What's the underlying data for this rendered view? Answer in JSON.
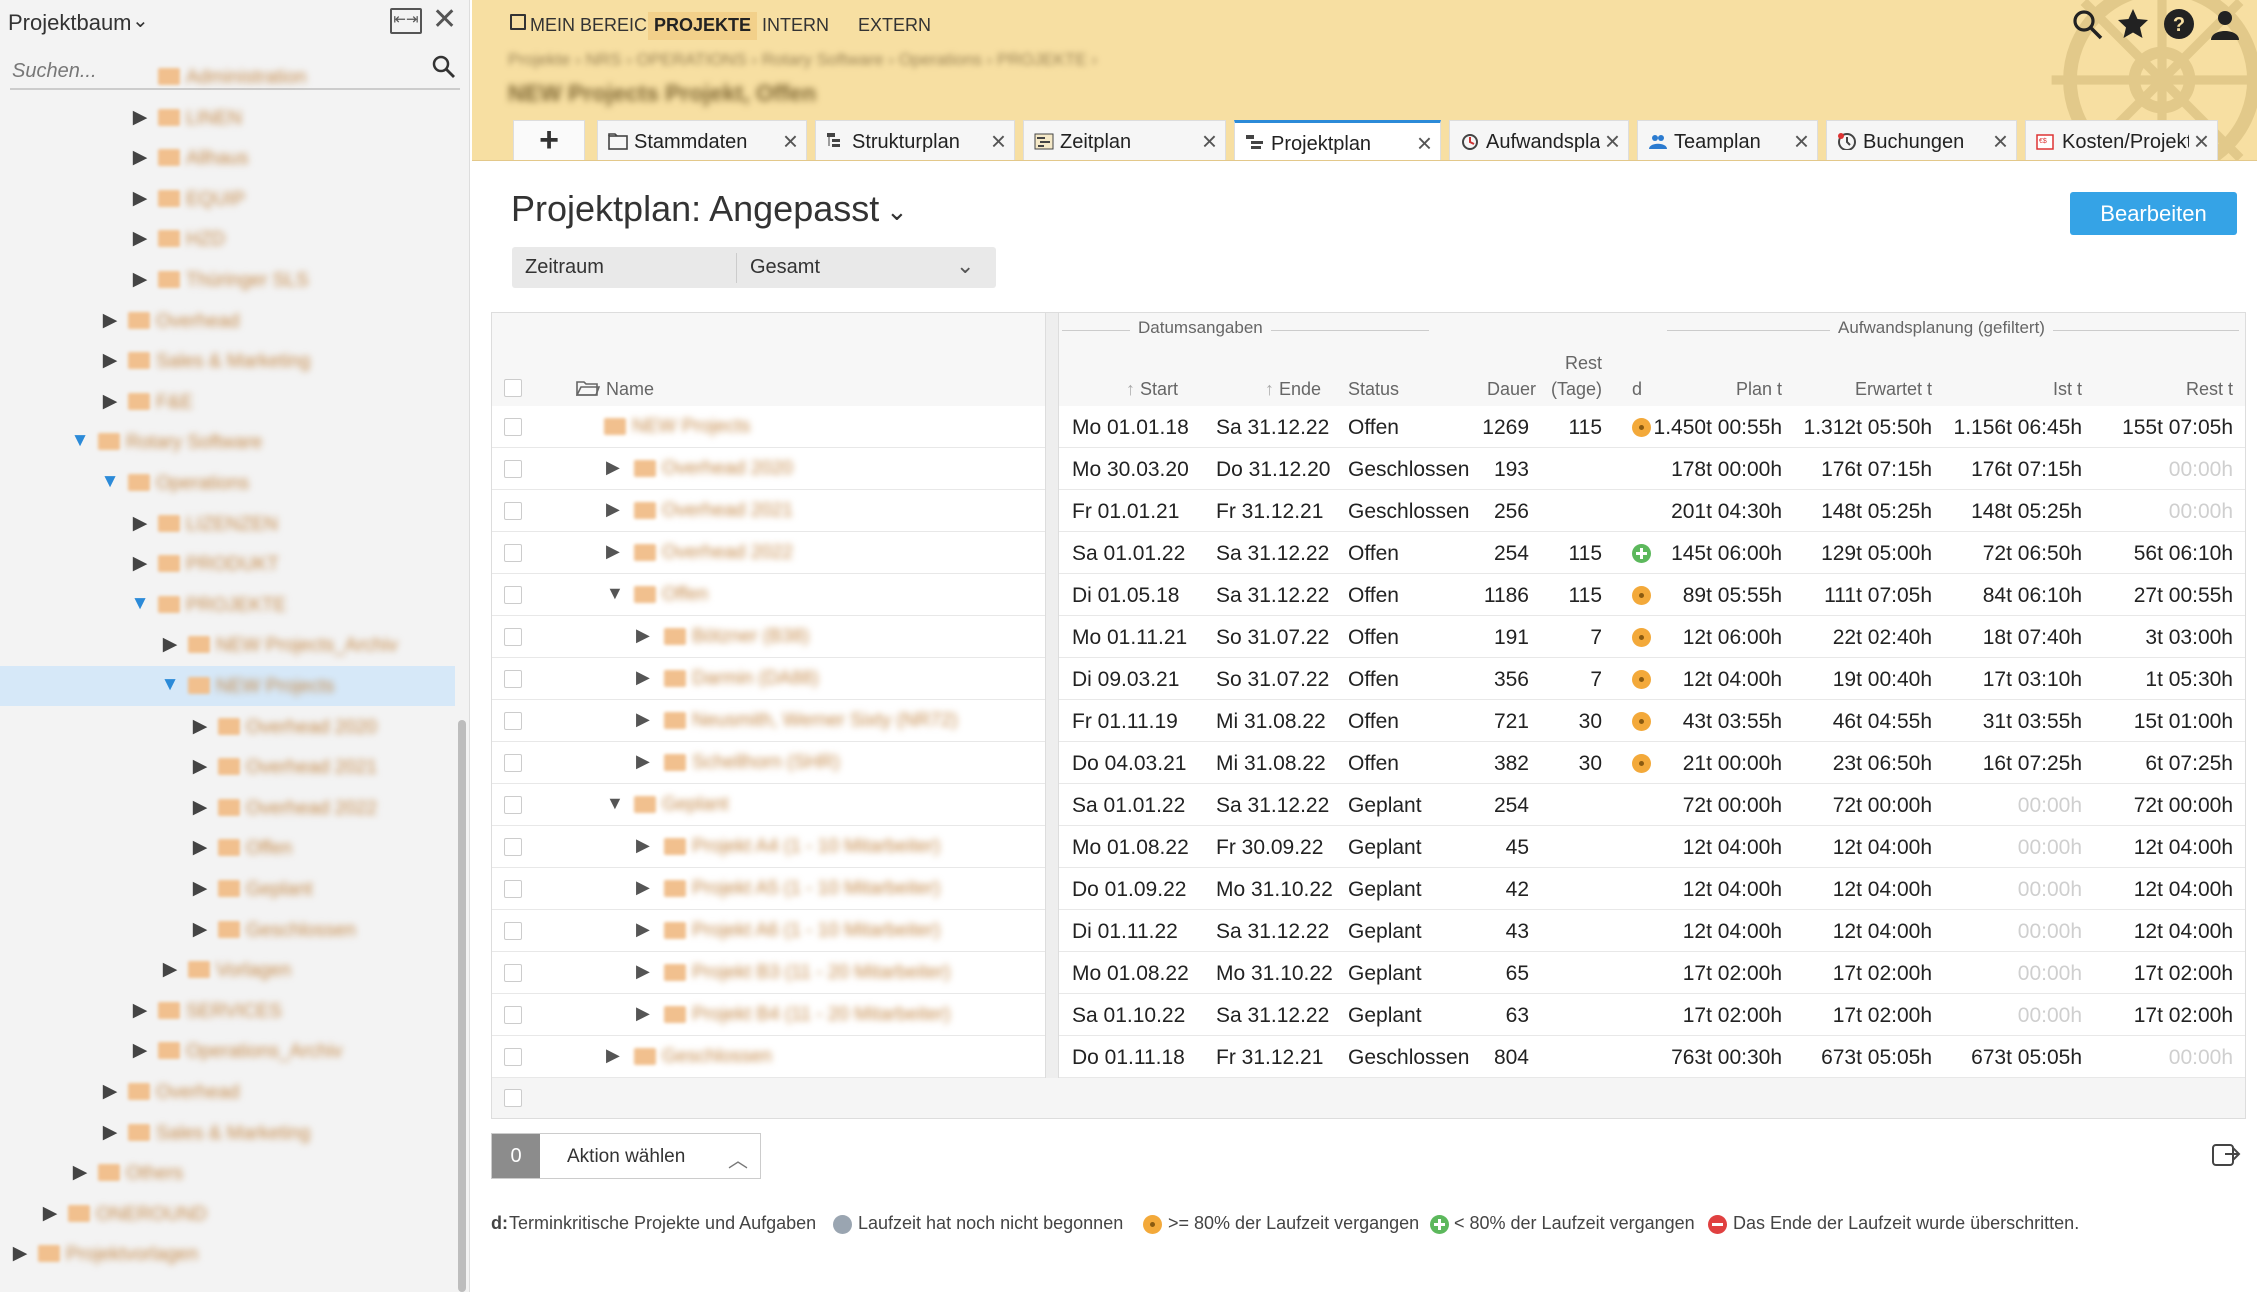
{
  "sidebar": {
    "title": "Projektbaum",
    "search_placeholder": "Suchen...",
    "items": [
      {
        "label": "Administration",
        "level": 4,
        "expanded": null
      },
      {
        "label": "LINEN",
        "level": 4,
        "expanded": false
      },
      {
        "label": "Allhaus",
        "level": 4,
        "expanded": false
      },
      {
        "label": "EQUIP",
        "level": 4,
        "expanded": false
      },
      {
        "label": "HZD",
        "level": 4,
        "expanded": false
      },
      {
        "label": "Thüringer SLS",
        "level": 4,
        "expanded": false
      },
      {
        "label": "Overhead",
        "level": 3,
        "expanded": false
      },
      {
        "label": "Sales & Marketing",
        "level": 3,
        "expanded": false
      },
      {
        "label": "F&E",
        "level": 3,
        "expanded": false
      },
      {
        "label": "Rotary Software",
        "level": 2,
        "expanded": true
      },
      {
        "label": "Operations",
        "level": 3,
        "expanded": true
      },
      {
        "label": "LIZENZEN",
        "level": 4,
        "expanded": false
      },
      {
        "label": "PRODUKT",
        "level": 4,
        "expanded": false
      },
      {
        "label": "PROJEKTE",
        "level": 4,
        "expanded": true
      },
      {
        "label": "NEW Projects_Archiv",
        "level": 5,
        "expanded": false
      },
      {
        "label": "NEW Projects",
        "level": 5,
        "expanded": true,
        "selected": true
      },
      {
        "label": "Overhead 2020",
        "level": 6,
        "expanded": false
      },
      {
        "label": "Overhead 2021",
        "level": 6,
        "expanded": false
      },
      {
        "label": "Overhead 2022",
        "level": 6,
        "expanded": false
      },
      {
        "label": "Offen",
        "level": 6,
        "expanded": false
      },
      {
        "label": "Geplant",
        "level": 6,
        "expanded": false
      },
      {
        "label": "Geschlossen",
        "level": 6,
        "expanded": false
      },
      {
        "label": "Vorlagen",
        "level": 5,
        "expanded": false
      },
      {
        "label": "SERVICES",
        "level": 4,
        "expanded": false
      },
      {
        "label": "Operations_Archiv",
        "level": 4,
        "expanded": false
      },
      {
        "label": "Overhead",
        "level": 3,
        "expanded": false
      },
      {
        "label": "Sales & Marketing",
        "level": 3,
        "expanded": false
      },
      {
        "label": "Others",
        "level": 2,
        "expanded": false
      },
      {
        "label": "ONEROUND",
        "level": 1,
        "expanded": false
      },
      {
        "label": "Projektvorlagen",
        "level": 0,
        "expanded": false
      }
    ]
  },
  "topnav": {
    "items": [
      "MEIN BEREICH",
      "PROJEKTE",
      "INTERN",
      "EXTERN"
    ],
    "active": "PROJEKTE"
  },
  "breadcrumb": "Projekte  ›  NRS  ›  OPERATIONS  ›  Rotary Software  ›  Operations  ›  PROJEKTE  ›",
  "context_title": "NEW Projects  Projekt, Offen",
  "tabs": [
    {
      "label": "Stammdaten",
      "icon": "folder-icon"
    },
    {
      "label": "Strukturplan",
      "icon": "structure-icon"
    },
    {
      "label": "Zeitplan",
      "icon": "gantt-icon"
    },
    {
      "label": "Projektplan",
      "icon": "plan-icon",
      "active": true
    },
    {
      "label": "Aufwandsplanung",
      "icon": "effort-icon"
    },
    {
      "label": "Teamplan",
      "icon": "team-icon"
    },
    {
      "label": "Buchungen",
      "icon": "booking-icon"
    },
    {
      "label": "Kosten/Projekt",
      "icon": "cost-icon"
    }
  ],
  "page": {
    "title": "Projektplan: Angepasst",
    "edit_button": "Bearbeiten",
    "period_label": "Zeitraum",
    "period_value": "Gesamt"
  },
  "grid": {
    "group_dates": "Datumsangaben",
    "group_effort": "Aufwandsplanung (gefiltert)",
    "columns": {
      "name": "Name",
      "start": "Start",
      "end": "Ende",
      "status": "Status",
      "duration": "Dauer",
      "rest_days_1": "Rest",
      "rest_days_2": "(Tage)",
      "d": "d",
      "plan": "Plan t",
      "estimated": "Erwartet t",
      "actual": "Ist t",
      "rest": "Rest t"
    },
    "rows": [
      {
        "name": "NEW Projects",
        "level": 0,
        "toggle": "",
        "start": "Mo 01.01.18",
        "end": "Sa 31.12.22",
        "status": "Offen",
        "duration": "1269",
        "rest_days": "115",
        "d": "orange",
        "plan": "1.450t 00:55h",
        "estimated": "1.312t 05:50h",
        "actual": "1.156t 06:45h",
        "rest": "155t 07:05h",
        "rest_muted": false
      },
      {
        "name": "Overhead 2020",
        "level": 1,
        "toggle": "▶",
        "start": "Mo 30.03.20",
        "end": "Do 31.12.20",
        "status": "Geschlossen",
        "duration": "193",
        "rest_days": "",
        "d": "",
        "plan": "178t 00:00h",
        "estimated": "176t 07:15h",
        "actual": "176t 07:15h",
        "rest": "00:00h",
        "rest_muted": true
      },
      {
        "name": "Overhead 2021",
        "level": 1,
        "toggle": "▶",
        "start": "Fr 01.01.21",
        "end": "Fr 31.12.21",
        "status": "Geschlossen",
        "duration": "256",
        "rest_days": "",
        "d": "",
        "plan": "201t 04:30h",
        "estimated": "148t 05:25h",
        "actual": "148t 05:25h",
        "rest": "00:00h",
        "rest_muted": true
      },
      {
        "name": "Overhead 2022",
        "level": 1,
        "toggle": "▶",
        "start": "Sa 01.01.22",
        "end": "Sa 31.12.22",
        "status": "Offen",
        "duration": "254",
        "rest_days": "115",
        "d": "green",
        "plan": "145t 06:00h",
        "estimated": "129t 05:00h",
        "actual": "72t 06:50h",
        "rest": "56t 06:10h",
        "rest_muted": false
      },
      {
        "name": "Offen",
        "level": 1,
        "toggle": "▼",
        "start": "Di 01.05.18",
        "end": "Sa 31.12.22",
        "status": "Offen",
        "duration": "1186",
        "rest_days": "115",
        "d": "orange",
        "plan": "89t 05:55h",
        "estimated": "111t 07:05h",
        "actual": "84t 06:10h",
        "rest": "27t 00:55h",
        "rest_muted": false
      },
      {
        "name": "Bötzner (B38)",
        "level": 2,
        "toggle": "▶",
        "start": "Mo 01.11.21",
        "end": "So 31.07.22",
        "status": "Offen",
        "duration": "191",
        "rest_days": "7",
        "d": "orange",
        "plan": "12t 06:00h",
        "estimated": "22t 02:40h",
        "actual": "18t 07:40h",
        "rest": "3t 03:00h",
        "rest_muted": false
      },
      {
        "name": "Darmin (DA88)",
        "level": 2,
        "toggle": "▶",
        "start": "Di 09.03.21",
        "end": "So 31.07.22",
        "status": "Offen",
        "duration": "356",
        "rest_days": "7",
        "d": "orange",
        "plan": "12t 04:00h",
        "estimated": "19t 00:40h",
        "actual": "17t 03:10h",
        "rest": "1t 05:30h",
        "rest_muted": false
      },
      {
        "name": "Neusmith, Werner Sixty (NR72)",
        "level": 2,
        "toggle": "▶",
        "start": "Fr 01.11.19",
        "end": "Mi 31.08.22",
        "status": "Offen",
        "duration": "721",
        "rest_days": "30",
        "d": "orange",
        "plan": "43t 03:55h",
        "estimated": "46t 04:55h",
        "actual": "31t 03:55h",
        "rest": "15t 01:00h",
        "rest_muted": false
      },
      {
        "name": "Schellhorn (SHR)",
        "level": 2,
        "toggle": "▶",
        "start": "Do 04.03.21",
        "end": "Mi 31.08.22",
        "status": "Offen",
        "duration": "382",
        "rest_days": "30",
        "d": "orange",
        "plan": "21t 00:00h",
        "estimated": "23t 06:50h",
        "actual": "16t 07:25h",
        "rest": "6t 07:25h",
        "rest_muted": false
      },
      {
        "name": "Geplant",
        "level": 1,
        "toggle": "▼",
        "start": "Sa 01.01.22",
        "end": "Sa 31.12.22",
        "status": "Geplant",
        "duration": "254",
        "rest_days": "",
        "d": "",
        "plan": "72t 00:00h",
        "estimated": "72t 00:00h",
        "actual": "00:00h",
        "rest": "72t 00:00h",
        "rest_muted": false,
        "actual_muted": true
      },
      {
        "name": "Projekt A4 (1 - 10 Mitarbeiter)",
        "level": 2,
        "toggle": "▶",
        "start": "Mo 01.08.22",
        "end": "Fr 30.09.22",
        "status": "Geplant",
        "duration": "45",
        "rest_days": "",
        "d": "",
        "plan": "12t 04:00h",
        "estimated": "12t 04:00h",
        "actual": "00:00h",
        "rest": "12t 04:00h",
        "rest_muted": false,
        "actual_muted": true
      },
      {
        "name": "Projekt A5 (1 - 10 Mitarbeiter)",
        "level": 2,
        "toggle": "▶",
        "start": "Do 01.09.22",
        "end": "Mo 31.10.22",
        "status": "Geplant",
        "duration": "42",
        "rest_days": "",
        "d": "",
        "plan": "12t 04:00h",
        "estimated": "12t 04:00h",
        "actual": "00:00h",
        "rest": "12t 04:00h",
        "rest_muted": false,
        "actual_muted": true
      },
      {
        "name": "Projekt A6 (1 - 10 Mitarbeiter)",
        "level": 2,
        "toggle": "▶",
        "start": "Di 01.11.22",
        "end": "Sa 31.12.22",
        "status": "Geplant",
        "duration": "43",
        "rest_days": "",
        "d": "",
        "plan": "12t 04:00h",
        "estimated": "12t 04:00h",
        "actual": "00:00h",
        "rest": "12t 04:00h",
        "rest_muted": false,
        "actual_muted": true
      },
      {
        "name": "Projekt B3 (11 - 20 Mitarbeiter)",
        "level": 2,
        "toggle": "▶",
        "start": "Mo 01.08.22",
        "end": "Mo 31.10.22",
        "status": "Geplant",
        "duration": "65",
        "rest_days": "",
        "d": "",
        "plan": "17t 02:00h",
        "estimated": "17t 02:00h",
        "actual": "00:00h",
        "rest": "17t 02:00h",
        "rest_muted": false,
        "actual_muted": true
      },
      {
        "name": "Projekt B4 (11 - 20 Mitarbeiter)",
        "level": 2,
        "toggle": "▶",
        "start": "Sa 01.10.22",
        "end": "Sa 31.12.22",
        "status": "Geplant",
        "duration": "63",
        "rest_days": "",
        "d": "",
        "plan": "17t 02:00h",
        "estimated": "17t 02:00h",
        "actual": "00:00h",
        "rest": "17t 02:00h",
        "rest_muted": false,
        "actual_muted": true
      },
      {
        "name": "Geschlossen",
        "level": 1,
        "toggle": "▶",
        "start": "Do 01.11.18",
        "end": "Fr 31.12.21",
        "status": "Geschlossen",
        "duration": "804",
        "rest_days": "",
        "d": "",
        "plan": "763t 00:30h",
        "estimated": "673t 05:05h",
        "actual": "673t 05:05h",
        "rest": "00:00h",
        "rest_muted": true
      }
    ]
  },
  "action": {
    "count": "0",
    "label": "Aktion wählen"
  },
  "legend": {
    "d_label": "d:",
    "d_text": "Terminkritische Projekte und Aufgaben",
    "not_started": "Laufzeit hat noch nicht begonnen",
    "ge80": ">= 80% der Laufzeit vergangen",
    "lt80": "< 80% der Laufzeit vergangen",
    "exceeded": "Das Ende der Laufzeit wurde überschritten.",
    "colors": {
      "grey": "#9aa5b1",
      "orange": "#f3a93a",
      "green": "#5cb85c",
      "red": "#e04040"
    }
  },
  "colors": {
    "accent": "#35a3e6",
    "topbar": "#f7dfa2",
    "selected_row": "#d6e8f8",
    "tab_active_border": "#2b8ad8"
  }
}
